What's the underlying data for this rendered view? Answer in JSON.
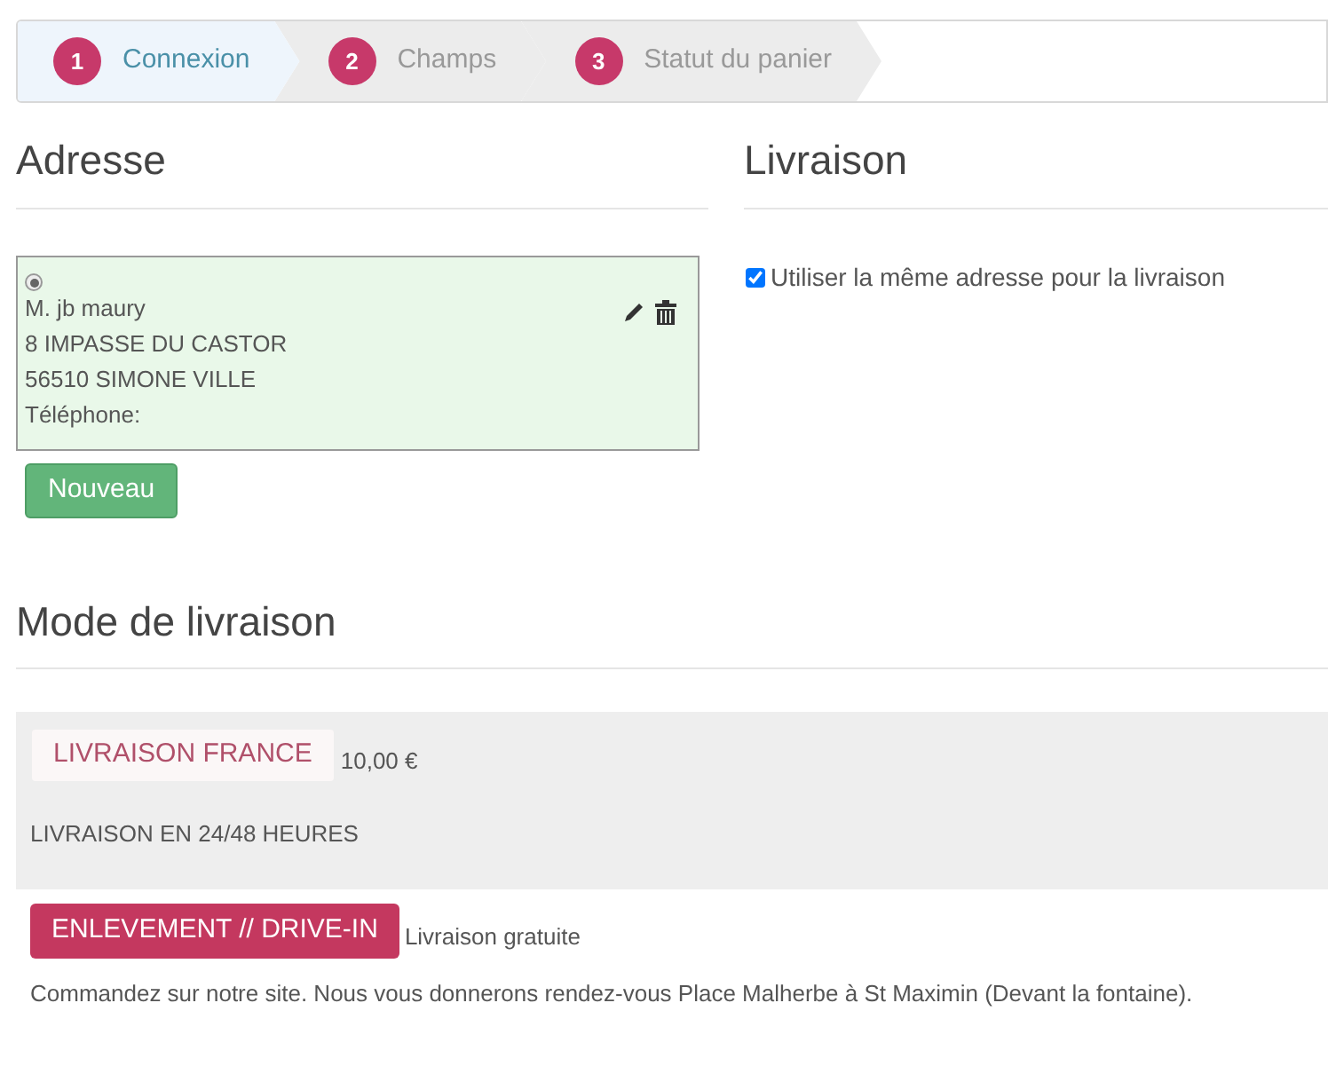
{
  "steps": [
    {
      "number": "1",
      "label": "Connexion",
      "selected": true
    },
    {
      "number": "2",
      "label": "Champs",
      "selected": false
    },
    {
      "number": "3",
      "label": "Statut du panier",
      "selected": false
    }
  ],
  "address": {
    "title": "Adresse",
    "selected": true,
    "lines": [
      "M. jb maury",
      "8 IMPASSE DU CASTOR",
      "56510 SIMONE VILLE",
      "Téléphone:"
    ],
    "new_button": "Nouveau"
  },
  "delivery": {
    "title": "Livraison",
    "same_address": {
      "label": "Utiliser la même adresse pour la livraison",
      "checked": true
    }
  },
  "shipping": {
    "title": "Mode de livraison",
    "options": [
      {
        "name": "LIVRAISON FRANCE",
        "price": "10,00 €",
        "description": "LIVRAISON EN 24/48 HEURES",
        "selected": false
      },
      {
        "name": "ENLEVEMENT // DRIVE-IN",
        "price": "Livraison gratuite",
        "description": "Commandez sur notre site. Nous vous donnerons rendez-vous Place Malherbe à St Maximin (Devant la fontaine).",
        "selected": true
      }
    ]
  }
}
